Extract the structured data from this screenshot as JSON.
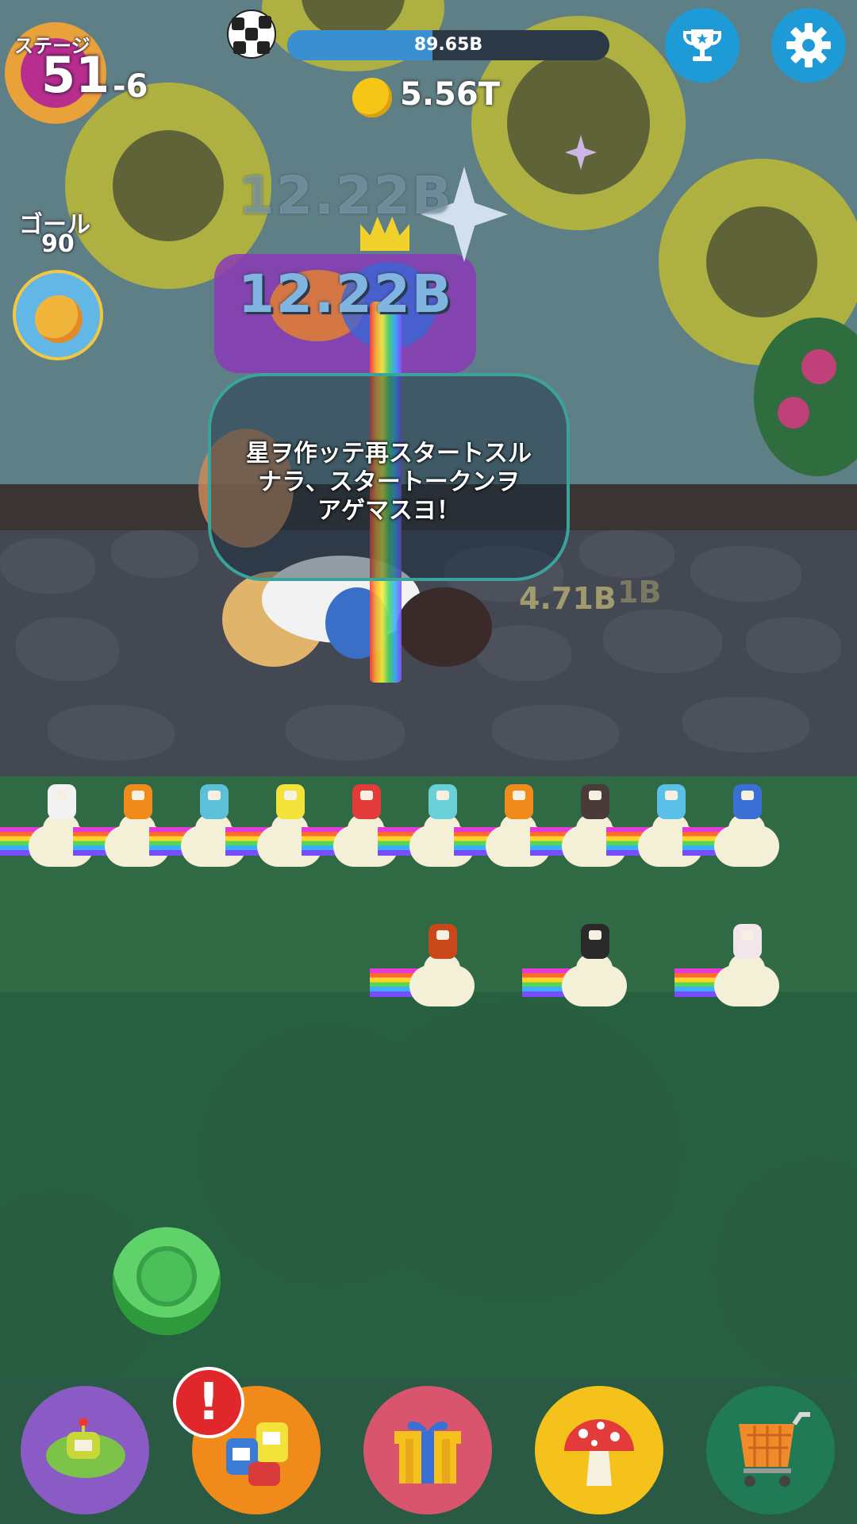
{
  "hud": {
    "stage_label": "ステージ",
    "stage_number": "51",
    "stage_sub": "-6",
    "goal_label": "ゴール",
    "goal_value": "90",
    "progress_text": "89.65B",
    "progress_fraction": 0.45,
    "coin_text": "5.56T"
  },
  "floating": {
    "size_ghost": "12.22B",
    "size_main": "12.22B",
    "small_a": "4.71B",
    "small_b": "1B"
  },
  "dialog": {
    "line1": "星ヲ作ッテ再スタートスル",
    "line2": "ナラ、スタートークンヲ",
    "line3": "アゲマスヨ！"
  },
  "icons": {
    "trophy": "trophy-icon",
    "settings": "gear-icon",
    "soccer": "soccer-ball-icon",
    "coin": "coin-icon",
    "goal": "planet-goal-icon",
    "restart_star": "green-star-icon",
    "nav_prince": "prince-icon",
    "nav_cousins": "cousins-icon",
    "nav_gift": "gift-icon",
    "nav_mushroom": "mushroom-icon",
    "nav_shop": "shopping-cart-icon",
    "alert": "!"
  },
  "colors": {
    "accent_blue": "#1e9ad6",
    "nav_purple": "#8a5bc4",
    "nav_orange": "#f08a1a",
    "nav_pink": "#d9556e",
    "nav_yellow": "#f4c21a",
    "nav_green": "#1f7a55",
    "alert_red": "#e0282c"
  }
}
